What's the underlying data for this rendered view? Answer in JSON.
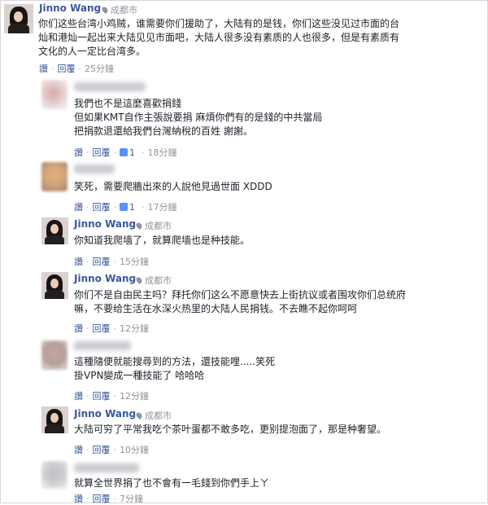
{
  "comments": [
    {
      "author": "Jinno Wang",
      "location": "成都市",
      "lines": [
        "你们这些台湾小鸡贼，谁需要你们援助了，大陆有的是钱，你们这些没见过市面的台",
        "灿和港灿一起出来大陆见见市面吧，大陆人很多没有素质的人也很多，但是有素质有",
        "文化的人一定比台湾多。"
      ],
      "actions": {
        "like": "讚",
        "reply": "回覆",
        "time": "25分鐘"
      }
    },
    {
      "author": "",
      "lines": [
        "我們也不是這麼喜歡捐錢",
        "但如果KMT自作主張說要捐 麻煩你們有的是錢的中共當局",
        "把捐款退還給我們台灣納稅的百姓 謝謝。"
      ],
      "actions": {
        "like": "讚",
        "reply": "回覆",
        "like_count": "1",
        "time": "18分鐘"
      }
    },
    {
      "author": "",
      "lines": [
        "笑死，需要爬牆出來的人說他見過世面 XDDD"
      ],
      "actions": {
        "like": "讚",
        "reply": "回覆",
        "like_count": "1",
        "time": "17分鐘"
      }
    },
    {
      "author": "Jinno Wang",
      "location": "成都市",
      "lines": [
        "你知道我爬墙了，就算爬墙也是种技能。"
      ],
      "actions": {
        "like": "讚",
        "reply": "回覆",
        "time": "15分鐘"
      }
    },
    {
      "author": "Jinno Wang",
      "location": "成都市",
      "lines": [
        "你们不是自由民主吗？拜托你们这么不愿意快去上街抗议或者围攻你们总统府",
        "嘛，不要给生活在水深火热里的大陆人民捐钱。不去瞧不起你呵呵"
      ],
      "actions": {
        "like": "讚",
        "reply": "回覆",
        "time": "12分鐘"
      }
    },
    {
      "author": "",
      "lines": [
        "這種隨便就能搜尋到的方法，還技能哩.....笑死",
        "掛VPN變成一種技能了 哈哈哈"
      ],
      "actions": {
        "like": "讚",
        "reply": "回覆",
        "time": "12分鐘"
      }
    },
    {
      "author": "Jinno Wang",
      "location": "成都市",
      "lines": [
        "大陆可穷了平常我吃个茶叶蛋都不敢多吃，更别提泡面了，那是种奢望。"
      ],
      "actions": {
        "like": "讚",
        "reply": "回覆",
        "time": "10分鐘"
      }
    },
    {
      "author": "",
      "lines": [
        "就算全世界捐了也不會有一毛錢到你們手上ㄚ"
      ],
      "actions": {
        "like": "讚",
        "reply": "回覆",
        "time": "7分鐘"
      }
    }
  ],
  "colors": {
    "link": "#3b5998",
    "meta": "#90949c",
    "text": "#1d2129",
    "like_badge": "#5890ff"
  },
  "icons": {
    "location": "map-pin-icon",
    "like": "thumbs-up-icon"
  }
}
